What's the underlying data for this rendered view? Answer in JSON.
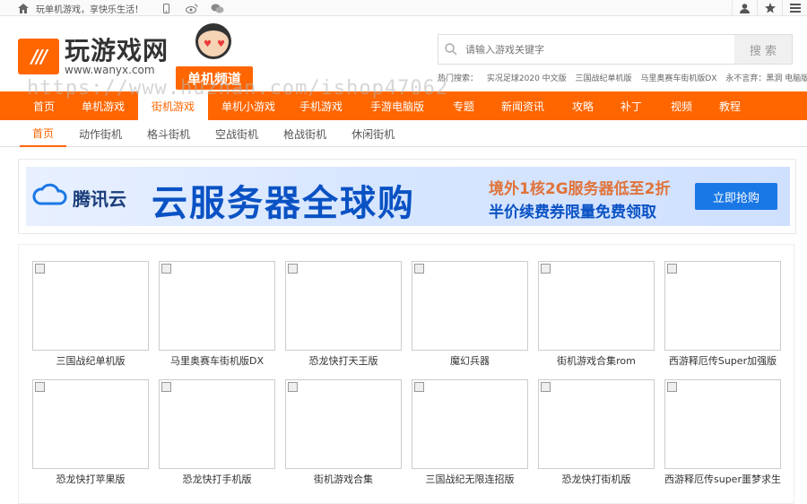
{
  "topbar": {
    "slogan": "玩单机游戏，享快乐生活！",
    "icons": [
      "home-icon",
      "phone-icon",
      "weibo-icon",
      "wechat-icon",
      "user-icon",
      "star-icon",
      "menu-icon"
    ]
  },
  "header": {
    "logo_mark": "///",
    "logo_cn": "玩游戏网",
    "logo_en": "www.wanyx.com",
    "channel_label": "单机频道",
    "watermark": "https://www.huzhan.com/ishop47062"
  },
  "search": {
    "placeholder": "请输入游戏关键字",
    "button": "搜 索",
    "hot_label": "热门搜索：",
    "hot_items": [
      "实况足球2020 中文版",
      "三国战纪单机版",
      "马里奥赛车街机版DX",
      "永不言弃：黑洞 电脑版"
    ]
  },
  "nav": {
    "items": [
      {
        "label": "首页",
        "active": false
      },
      {
        "label": "单机游戏",
        "active": false
      },
      {
        "label": "街机游戏",
        "active": true
      },
      {
        "label": "单机小游戏",
        "active": false
      },
      {
        "label": "手机游戏",
        "active": false
      },
      {
        "label": "手游电脑版",
        "active": false
      },
      {
        "label": "专题",
        "active": false
      },
      {
        "label": "新闻资讯",
        "active": false
      },
      {
        "label": "攻略",
        "active": false
      },
      {
        "label": "补丁",
        "active": false
      },
      {
        "label": "视频",
        "active": false
      },
      {
        "label": "教程",
        "active": false
      }
    ]
  },
  "subnav": {
    "items": [
      {
        "label": "首页",
        "active": true
      },
      {
        "label": "动作街机",
        "active": false
      },
      {
        "label": "格斗街机",
        "active": false
      },
      {
        "label": "空战街机",
        "active": false
      },
      {
        "label": "枪战街机",
        "active": false
      },
      {
        "label": "休闲街机",
        "active": false
      }
    ]
  },
  "banner": {
    "brand": "腾讯云",
    "headline": "云服务器全球购",
    "line1": "境外1核2G服务器低至2折",
    "line2": "半价续费券限量免费领取",
    "cta": "立即抢购",
    "colors": {
      "primary": "#0a52c4",
      "accent": "#e0733a",
      "cta": "#1a78e6"
    }
  },
  "games": [
    {
      "name": "三国战纪单机版"
    },
    {
      "name": "马里奥赛车街机版DX"
    },
    {
      "name": "恐龙快打天王版"
    },
    {
      "name": "魔幻兵器"
    },
    {
      "name": "街机游戏合集rom"
    },
    {
      "name": "西游释厄传Super加强版"
    },
    {
      "name": "恐龙快打苹果版"
    },
    {
      "name": "恐龙快打手机版"
    },
    {
      "name": "街机游戏合集"
    },
    {
      "name": "三国战纪无限连招版"
    },
    {
      "name": "恐龙快打街机版"
    },
    {
      "name": "西游释厄传super噩梦求生"
    }
  ],
  "theme": {
    "brand_orange": "#ff6600"
  }
}
